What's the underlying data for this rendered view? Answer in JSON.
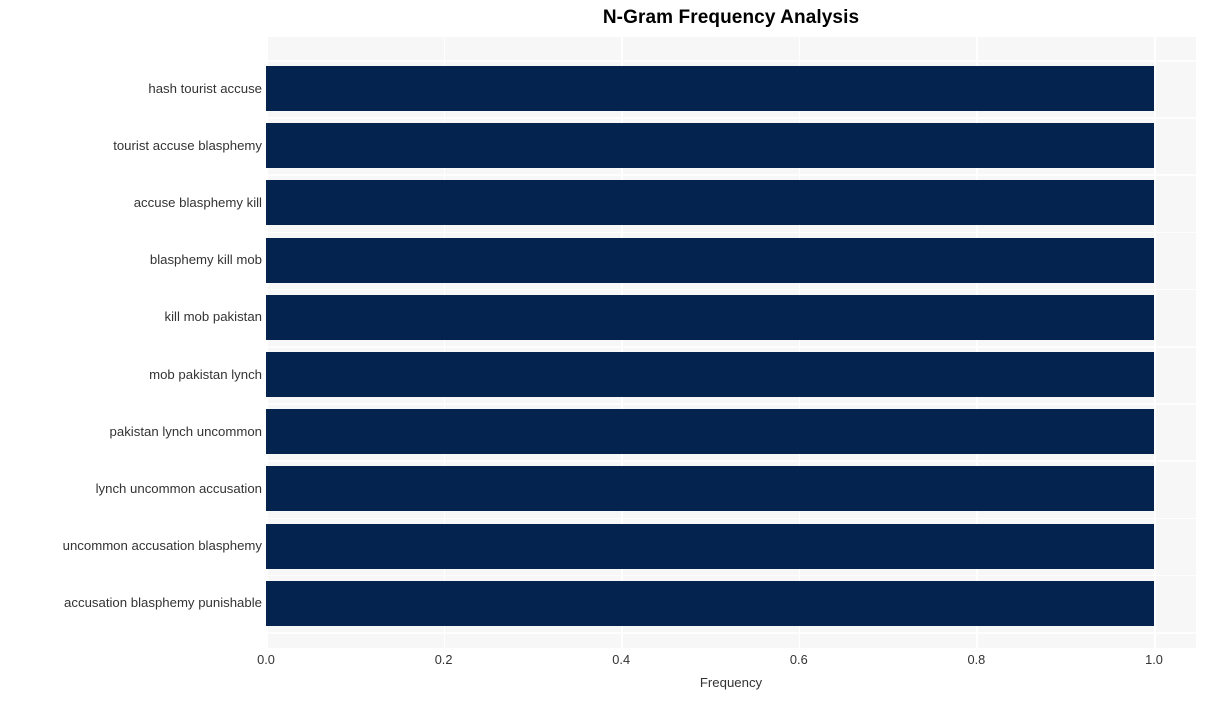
{
  "chart_data": {
    "type": "bar",
    "orientation": "horizontal",
    "title": "N-Gram Frequency Analysis",
    "xlabel": "Frequency",
    "ylabel": "",
    "xlim": [
      0.0,
      1.0
    ],
    "xticks": [
      "0.0",
      "0.2",
      "0.4",
      "0.6",
      "0.8",
      "1.0"
    ],
    "xtick_values": [
      0.0,
      0.2,
      0.4,
      0.6,
      0.8,
      1.0
    ],
    "grid": true,
    "legend": "none",
    "bar_color": "#04234f",
    "plot_background": "#f7f7f7",
    "figure_background": "#ffffff",
    "categories": [
      "hash tourist accuse",
      "tourist accuse blasphemy",
      "accuse blasphemy kill",
      "blasphemy kill mob",
      "kill mob pakistan",
      "mob pakistan lynch",
      "pakistan lynch uncommon",
      "lynch uncommon accusation",
      "uncommon accusation blasphemy",
      "accusation blasphemy punishable"
    ],
    "values": [
      1.0,
      1.0,
      1.0,
      1.0,
      1.0,
      1.0,
      1.0,
      1.0,
      1.0,
      1.0
    ]
  }
}
